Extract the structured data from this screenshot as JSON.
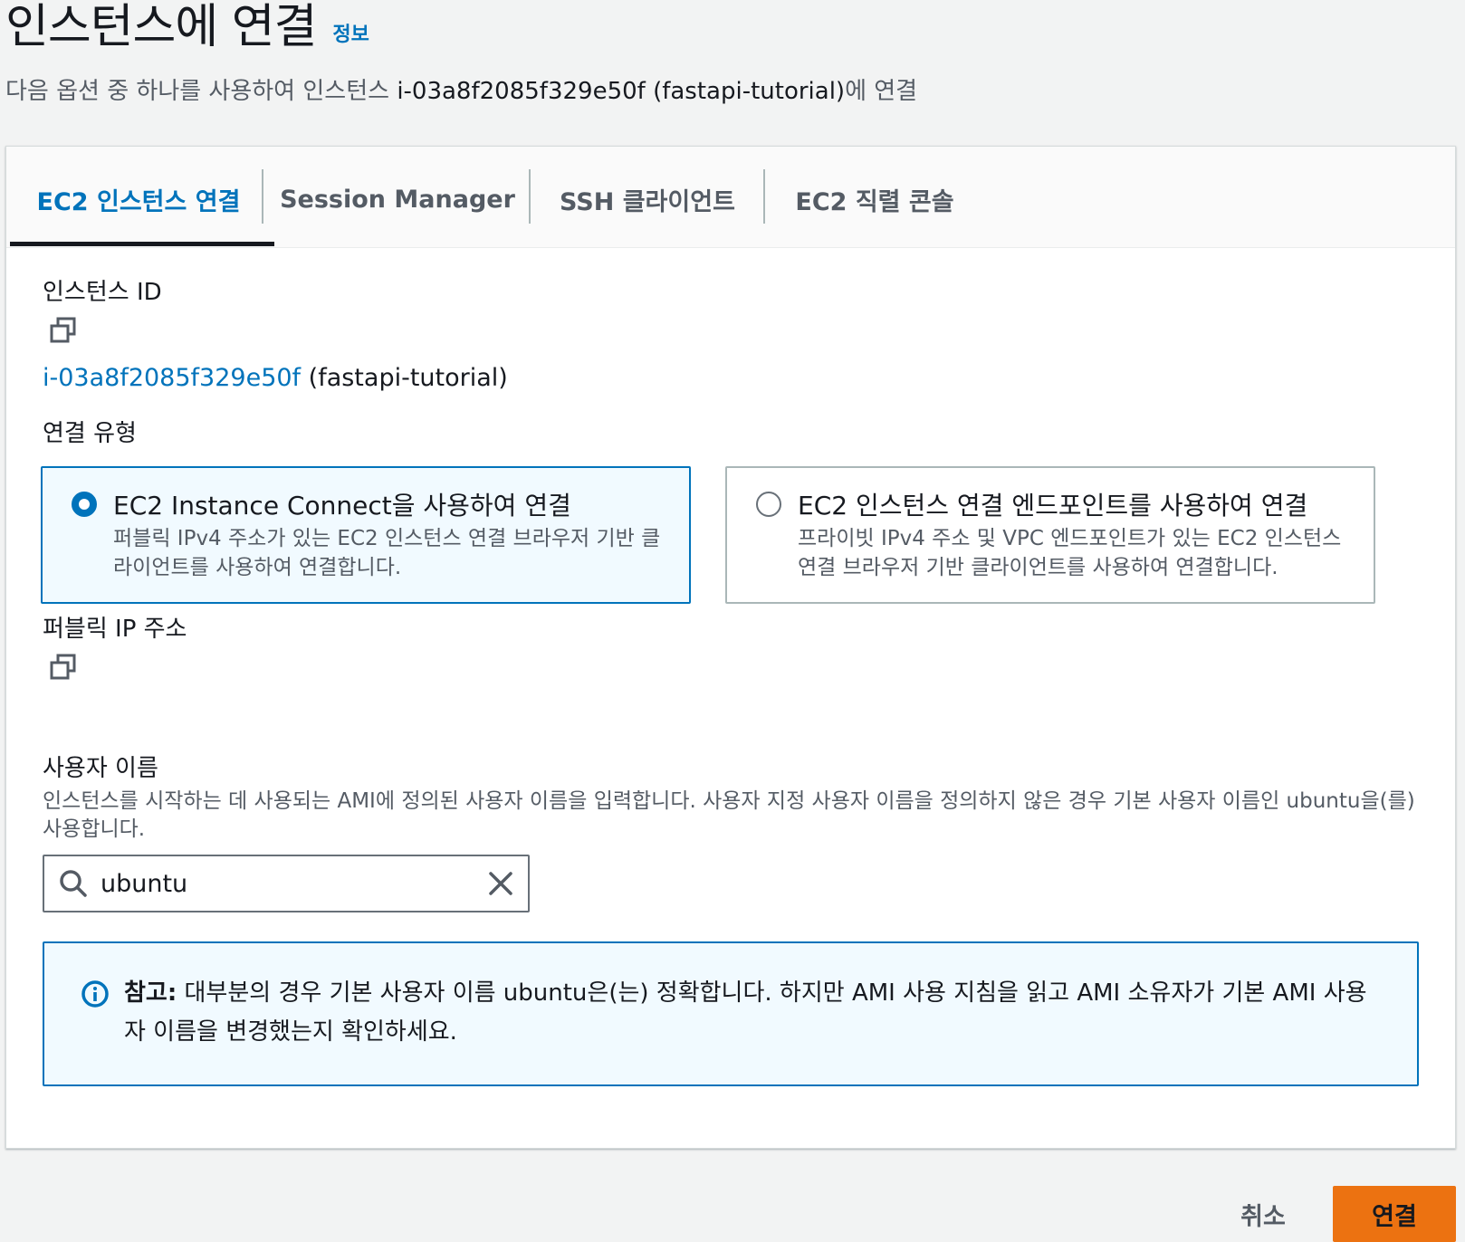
{
  "header": {
    "title": "인스턴스에 연결",
    "info_link": "정보",
    "subtitle_prefix": "다음 옵션 중 하나를 사용하여 인스턴스 ",
    "subtitle_instance": "i-03a8f2085f329e50f (fastapi-tutorial)",
    "subtitle_suffix": "에 연결"
  },
  "tabs": [
    {
      "label": "EC2 인스턴스 연결",
      "active": true
    },
    {
      "label": "Session Manager",
      "active": false
    },
    {
      "label": "SSH 클라이언트",
      "active": false
    },
    {
      "label": "EC2 직렬 콘솔",
      "active": false
    }
  ],
  "instance": {
    "label": "인스턴스 ID",
    "id": "i-03a8f2085f329e50f",
    "name": "(fastapi-tutorial)"
  },
  "connection_type": {
    "label": "연결 유형",
    "options": [
      {
        "title": "EC2 Instance Connect을 사용하여 연결",
        "description": "퍼블릭 IPv4 주소가 있는 EC2 인스턴스 연결 브라우저 기반 클라이언트를 사용하여 연결합니다.",
        "selected": true
      },
      {
        "title": "EC2 인스턴스 연결 엔드포인트를 사용하여 연결",
        "description": "프라이빗 IPv4 주소 및 VPC 엔드포인트가 있는 EC2 인스턴스 연결 브라우저 기반 클라이언트를 사용하여 연결합니다.",
        "selected": false
      }
    ]
  },
  "public_ip": {
    "label": "퍼블릭 IP 주소"
  },
  "username": {
    "label": "사용자 이름",
    "help": "인스턴스를 시작하는 데 사용되는 AMI에 정의된 사용자 이름을 입력합니다. 사용자 지정 사용자 이름을 정의하지 않은 경우 기본 사용자 이름인 ubuntu을(를) 사용합니다.",
    "value": "ubuntu"
  },
  "alert": {
    "strong": "참고:",
    "text": " 대부분의 경우 기본 사용자 이름 ubuntu은(는) 정확합니다. 하지만 AMI 사용 지침을 읽고 AMI 소유자가 기본 AMI 사용자 이름을 변경했는지 확인하세요."
  },
  "footer": {
    "cancel_label": "취소",
    "connect_label": "연결"
  },
  "colors": {
    "link": "#0073bb",
    "primary_button": "#ec7211",
    "selected_tile_bg": "#f1faff"
  },
  "icons": [
    "copy-icon",
    "search-icon",
    "close-icon",
    "info-icon"
  ]
}
